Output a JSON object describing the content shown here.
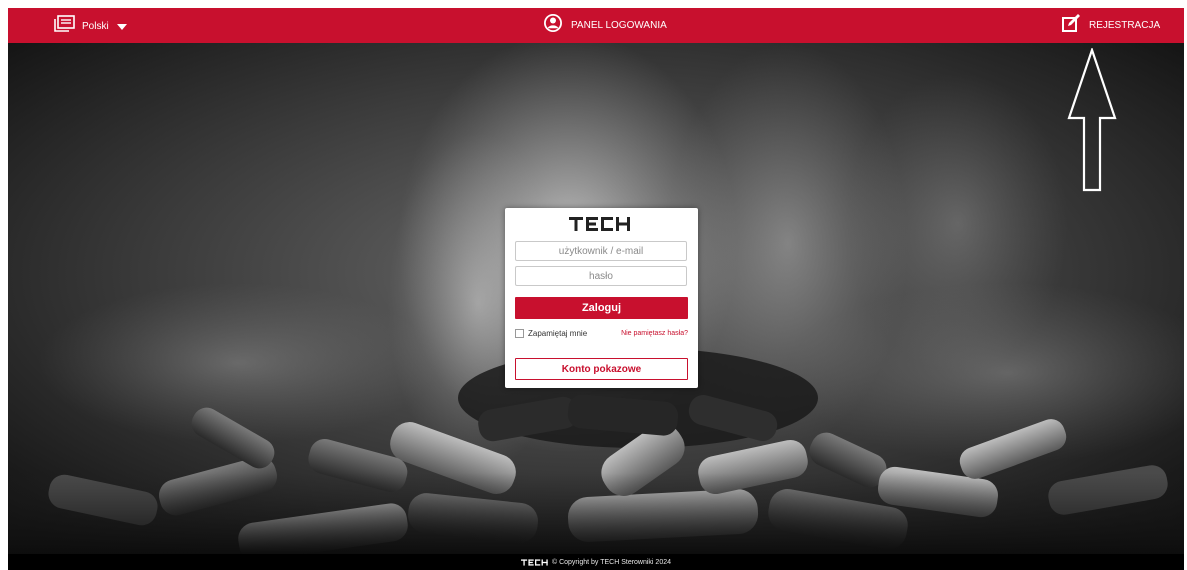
{
  "topbar": {
    "language": {
      "label": "Polski",
      "icon": "language-icon"
    },
    "panel": {
      "label": "PANEL LOGOWANIA",
      "icon": "user-icon"
    },
    "register": {
      "label": "REJESTRACJA",
      "icon": "edit-icon"
    }
  },
  "login": {
    "logo": "TECH",
    "username_placeholder": "użytkownik / e-mail",
    "password_placeholder": "hasło",
    "submit_label": "Zaloguj",
    "remember_label": "Zapamiętaj mnie",
    "forgot_label": "Nie pamiętasz hasła?",
    "demo_label": "Konto pokazowe"
  },
  "footer": {
    "logo": "TECH",
    "copyright": "© Copyright by TECH Sterowniki 2024"
  },
  "colors": {
    "brand": "#c8102e",
    "footer_bg": "#000000"
  }
}
